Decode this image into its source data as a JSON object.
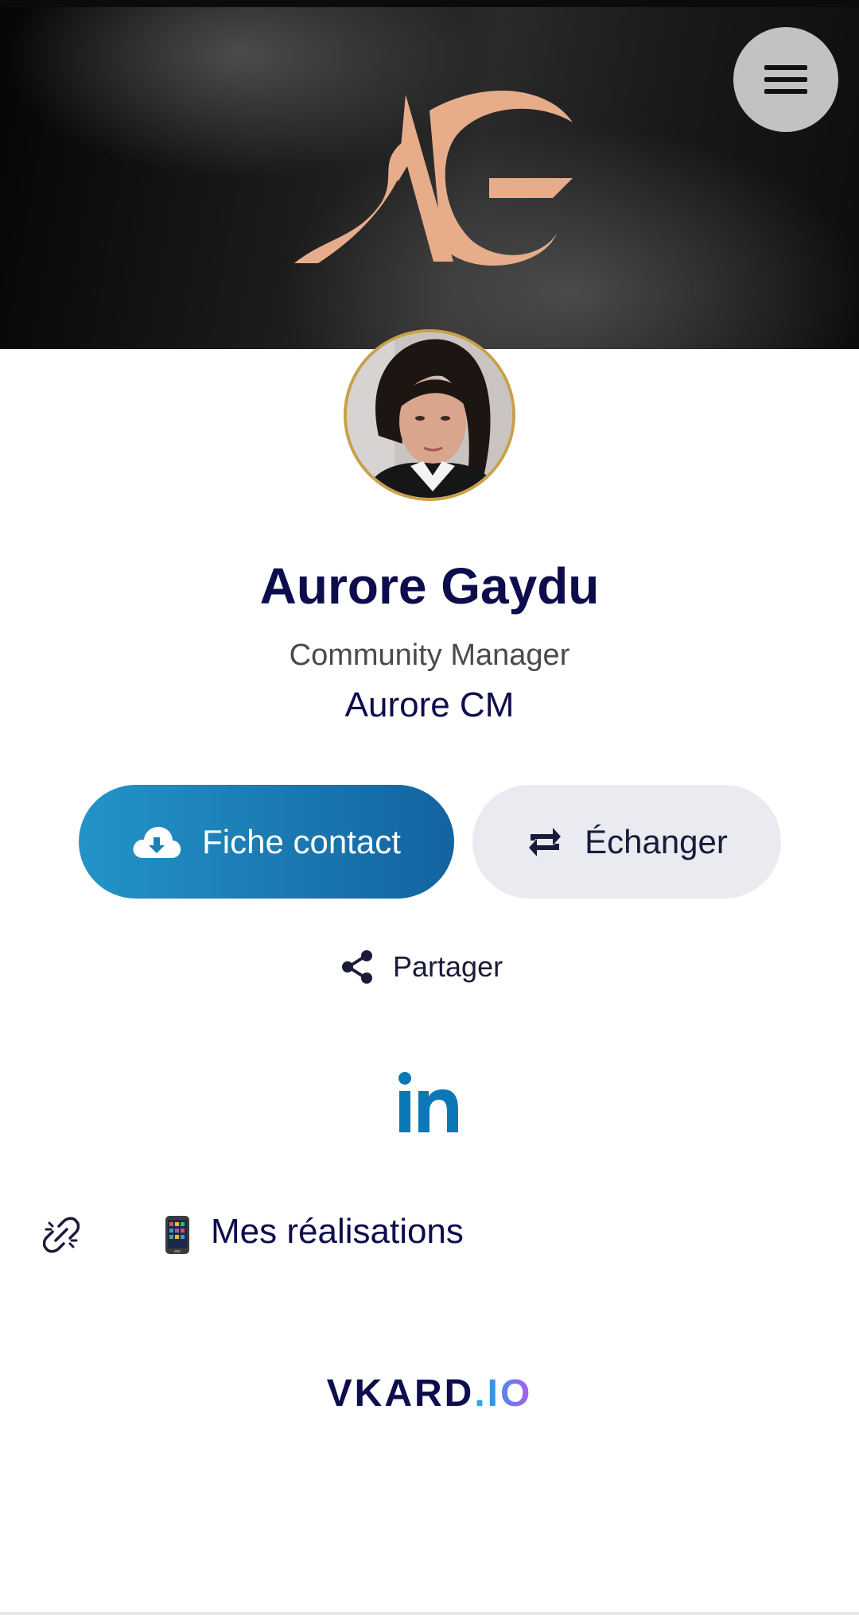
{
  "profile": {
    "name": "Aurore Gaydu",
    "job_title": "Community Manager",
    "company": "Aurore CM"
  },
  "cover": {
    "logo_text": "AG",
    "logo_color": "#e7ad8b",
    "background_color": "#1b1b1b"
  },
  "header": {
    "menu_icon": "hamburger-menu-icon"
  },
  "actions": {
    "contact_label": "Fiche contact",
    "contact_icon": "cloud-download-icon",
    "exchange_label": "Échanger",
    "exchange_icon": "repeat-arrows-icon",
    "share_label": "Partager",
    "share_icon": "share-icon"
  },
  "social": {
    "linkedin_icon": "linkedin-icon",
    "linkedin_color": "#0a78b5"
  },
  "links": [
    {
      "icon": "broken-link-icon",
      "emoji_icon": "mobile-phone-icon",
      "label": "Mes réalisations"
    }
  ],
  "footer": {
    "brand_main": "VKARD",
    "brand_dot": ".",
    "brand_suffix": "IO"
  },
  "colors": {
    "accent_blue": "#1b7fb8",
    "name_navy": "#0d0d4d",
    "avatar_border": "#c9a04a",
    "menu_button_bg": "#c2c2c2",
    "exchange_button_bg": "#e9ebf0"
  }
}
